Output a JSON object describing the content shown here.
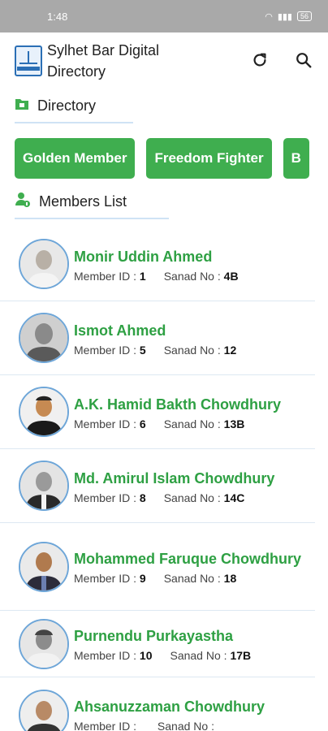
{
  "status": {
    "time": "1:48",
    "battery": "56"
  },
  "app": {
    "title": "Sylhet Bar Digital Directory"
  },
  "directory": {
    "heading": "Directory"
  },
  "categories": [
    "Golden Member",
    "Freedom Fighter",
    "B"
  ],
  "members_heading": "Members List",
  "labels": {
    "member_id": "Member ID :",
    "sanad_no": "Sanad No :"
  },
  "members": [
    {
      "name": "Monir Uddin Ahmed",
      "id": "1",
      "sanad": "4B"
    },
    {
      "name": "Ismot Ahmed",
      "id": "5",
      "sanad": "12"
    },
    {
      "name": "A.K. Hamid Bakth Chowdhury",
      "id": "6",
      "sanad": "13B"
    },
    {
      "name": "Md. Amirul Islam Chowdhury",
      "id": "8",
      "sanad": "14C"
    },
    {
      "name": "Mohammed Faruque Chowdhury",
      "id": "9",
      "sanad": "18"
    },
    {
      "name": "Purnendu Purkayastha",
      "id": "10",
      "sanad": "17B"
    },
    {
      "name": "Ahsanuzzaman Chowdhury",
      "id": "",
      "sanad": ""
    }
  ],
  "colors": {
    "accent": "#3fae4f",
    "name_green": "#2ea043",
    "divider": "#cfe3f5"
  }
}
